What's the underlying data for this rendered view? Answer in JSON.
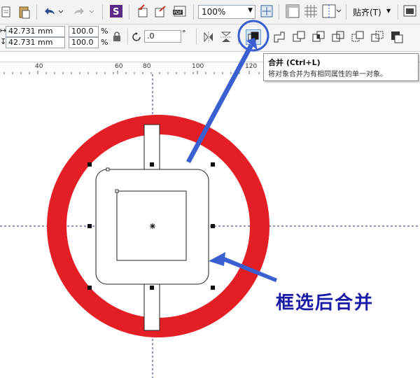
{
  "toolbar": {
    "zoom": "100%",
    "snap_label": "贴齐(T)"
  },
  "properties": {
    "width": "42.731 mm",
    "height": "42.731 mm",
    "scale_x": "100.0",
    "scale_y": "100.0",
    "percent": "%",
    "rotation": ".0",
    "degree": "°"
  },
  "ruler": {
    "labels": [
      "40",
      "60",
      "80",
      "100",
      "120"
    ]
  },
  "tooltip": {
    "title": "合并 (Ctrl+L)",
    "description": "将对象合并为有相同属性的单一对象。"
  },
  "annotation": {
    "caption": "框选后合并"
  },
  "colors": {
    "ring": "#e31e24",
    "annotation": "#1a1aa6",
    "arrow": "#3a5fd0"
  }
}
